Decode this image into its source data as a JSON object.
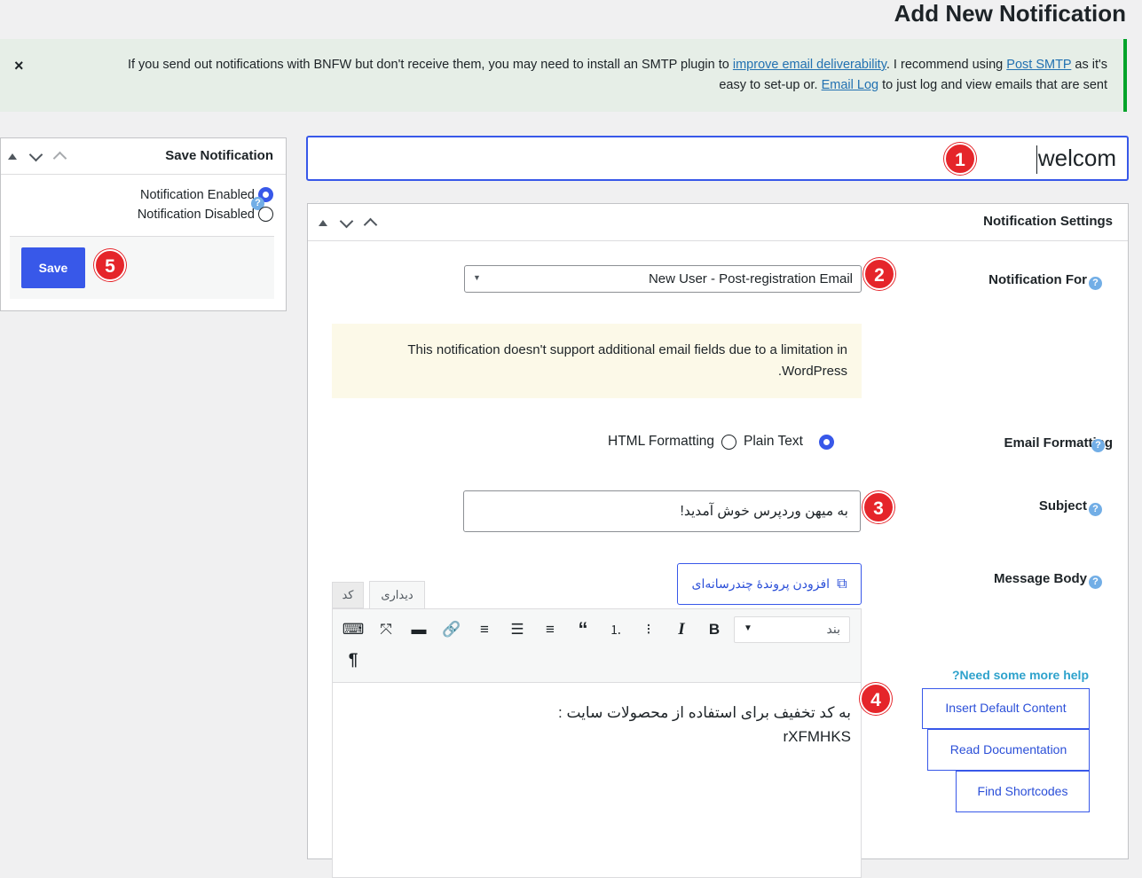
{
  "page_title": "Add New Notification",
  "notice": {
    "close": "×",
    "text_1": "If you send out notifications with BNFW but don't receive them, you may need to install an SMTP plugin to",
    "link_1": "improve email deliverability",
    "text_2": ". I recommend using",
    "link_2": "Post SMTP",
    "text_3": "as it's",
    "text_4": "easy to set-up or.",
    "link_3": "Email Log",
    "text_5": "to just log and view emails that are sent"
  },
  "title_input": {
    "value": "welcom"
  },
  "save_box": {
    "title": "Save Notification",
    "enabled_label": "Notification Enabled",
    "disabled_label": "Notification Disabled",
    "save_label": "Save"
  },
  "settings": {
    "title": "Notification Settings",
    "notification_for_label": "Notification For",
    "notification_for_value": "New User - Post-registration Email",
    "warning_line_1": "This notification doesn't support additional email fields due to a limitation in",
    "warning_line_2": ".WordPress",
    "email_formatting_label": "Email Formatting",
    "html_option": "HTML Formatting",
    "plain_option": "Plain Text",
    "subject_label": "Subject",
    "subject_value": "به میهن وردپرس خوش آمدید!",
    "message_body_label": "Message Body",
    "add_media_label": "افزودن پروندهٔ چندرسانه‌ای",
    "tab_visual": "دیداری",
    "tab_code": "کد",
    "format_select": "بند",
    "editor_line_1": "به کد تخفیف برای استفاده از محصولات سایت :",
    "editor_line_2": "rXFMHKS",
    "help_heading": "?Need some more help",
    "insert_default": "Insert Default Content",
    "read_docs": "Read Documentation",
    "find_shortcodes": "Find Shortcodes"
  },
  "badges": [
    "1",
    "2",
    "3",
    "4",
    "5"
  ],
  "colors": {
    "accent": "#3858e9",
    "badge": "#e5252a",
    "notice_border": "#00a32a",
    "help": "#72aee6"
  }
}
